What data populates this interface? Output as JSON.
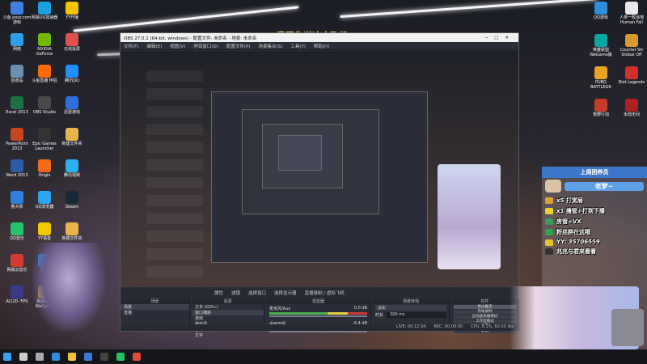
{
  "desktop": {
    "left_icons": [
      {
        "label": "斗鱼\npour.com\n游戏",
        "color": "#3f7fdf"
      },
      {
        "label": "网易UU加速器",
        "color": "#1aa3d9"
      },
      {
        "label": "YY开播",
        "color": "#f2c400"
      },
      {
        "label": "网络",
        "color": "#2f9ee8"
      },
      {
        "label": "NVIDIA\nGeForce",
        "color": "#76b900"
      },
      {
        "label": "无线投屏",
        "color": "#e05050"
      },
      {
        "label": "回收站",
        "color": "#6a8fb0"
      },
      {
        "label": "斗鱼直播\n伴侣",
        "color": "#ff6b00"
      },
      {
        "label": "腾讯QQ",
        "color": "#1e90ff"
      },
      {
        "label": "Excel 2013",
        "color": "#1d7044"
      },
      {
        "label": "OBS Studio",
        "color": "#4a4a4a"
      },
      {
        "label": "迅雷游戏",
        "color": "#2f6fd8"
      },
      {
        "label": "PowerPoint\n2013",
        "color": "#c6471f"
      },
      {
        "label": "Epic Games\nLauncher",
        "color": "#333333"
      },
      {
        "label": "新建文件夹",
        "color": "#e8b44a"
      },
      {
        "label": "Word 2013",
        "color": "#2b5aa8"
      },
      {
        "label": "Origin",
        "color": "#f56a1a"
      },
      {
        "label": "腾讯视频",
        "color": "#2bb0f0"
      },
      {
        "label": "鲁大师",
        "color": "#2f7ee0"
      },
      {
        "label": "QQ浏览器",
        "color": "#2aa5ef"
      },
      {
        "label": "Steam",
        "color": "#1b2838"
      },
      {
        "label": "QQ音乐",
        "color": "#26c36d"
      },
      {
        "label": "YY语音",
        "color": "#f5c900"
      },
      {
        "label": "新建文件夹",
        "color": "#e8b44a"
      },
      {
        "label": "网易云音乐",
        "color": "#d43c33"
      },
      {
        "label": "优酷",
        "color": "#1f8fe5"
      },
      {
        "label": "QQ音乐",
        "color": "#26c36d"
      },
      {
        "label": "AI120-\nFPS",
        "color": "#3a3a8a"
      },
      {
        "label": "英雄联盟\nWeGame",
        "color": "#c89b3c"
      }
    ],
    "right_icons": [
      {
        "label": "QQ游戏",
        "color": "#2f8cd8"
      },
      {
        "label": "人类一败涂地\nHuman Fall",
        "color": "#e8e8e8"
      },
      {
        "label": "英雄联盟\nWeGame版",
        "color": "#0ba6a0"
      },
      {
        "label": "Counter-Str\nGlobal Off",
        "color": "#d69a2d"
      },
      {
        "label": "PUBG\nBATTLEGR",
        "color": "#e7a322"
      },
      {
        "label": "Riot\nLegends",
        "color": "#d4302b"
      },
      {
        "label": "荒野行动",
        "color": "#c43b2a"
      },
      {
        "label": "永劫无间",
        "color": "#aa2222"
      }
    ],
    "banner_text": "我跟你说这个飞机"
  },
  "obs": {
    "window_title": "OBS 27.0.1 (64-bit, windows) - 配置文件: 未命名 - 场景: 未命名",
    "menu": [
      "文件(F)",
      "编辑(E)",
      "视图(V)",
      "停靠窗口(D)",
      "配置文件(P)",
      "场景集合(S)",
      "工具(T)",
      "帮助(H)"
    ],
    "bottom_tabs": [
      "属性",
      "滤镜",
      "选择窗口",
      "选择显示器",
      "直播录制 / 虚拟飞机"
    ],
    "docks": {
      "scenes_title": "场景",
      "scenes": [
        "场景",
        "直播"
      ],
      "sources_title": "来源",
      "sources": [
        "文本 (GDI+)",
        "窗口捕获",
        "游戏",
        "媒体源",
        "图片",
        "文字"
      ],
      "mixer_title": "混音器",
      "mixer": [
        {
          "name": "麦克风/Aux",
          "level": "0.0 dB"
        },
        {
          "name": "桌面音频",
          "level": "-6.4 dB"
        }
      ],
      "transition_title": "场景转场",
      "transition_type": "淡出",
      "transition_duration_label": "时长",
      "transition_duration": "300 ms",
      "controls_title": "控件",
      "controls": [
        "停止推流",
        "开始录制",
        "启动虚拟摄像机",
        "工作室模式",
        "设置",
        "退出"
      ]
    },
    "status": {
      "live": "LIVE: 00:12:34",
      "rec": "REC: 00:00:00",
      "cpu": "CPU: 8.1%, 60.00 fps"
    }
  },
  "stream_panel": {
    "title": "上周团养员",
    "badge_name": "老梦~",
    "gifts": [
      {
        "text": "x5 打赏局",
        "color": "#e0a030"
      },
      {
        "text": "x1 撸管+打到下播",
        "color": "#f0d030"
      },
      {
        "text": "房管+VX",
        "color": "#3a9a58"
      },
      {
        "text": "粉丝群在这哦",
        "color": "#2aa84a"
      },
      {
        "text": "YY: 35706559",
        "color": "#e8c030"
      },
      {
        "text": "兆兆与君来看看",
        "color": "#333333"
      }
    ]
  },
  "taskbar": {
    "icons": [
      "windows-start",
      "search",
      "task-view",
      "edge",
      "explorer",
      "store",
      "obs",
      "wechat",
      "chrome"
    ]
  }
}
